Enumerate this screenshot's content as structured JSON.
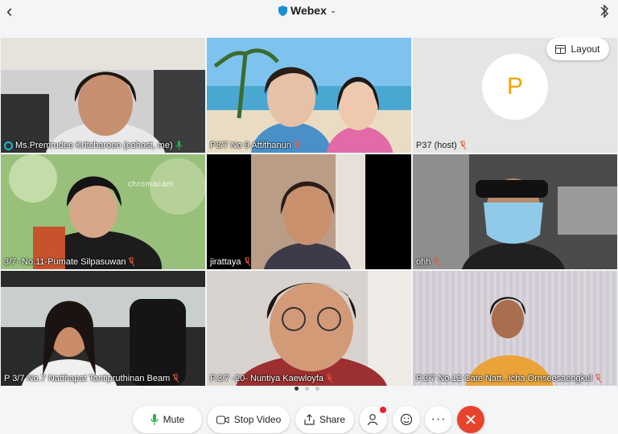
{
  "header": {
    "title": "Webex",
    "brand_color": "#1a8fd8"
  },
  "layout_button": {
    "label": "Layout",
    "icon": "layout-grid-icon"
  },
  "tiles": [
    {
      "name": "Ms.Premrudee Kritcharoen (cohost, me)",
      "mic": "green",
      "active": true
    },
    {
      "name": "P3/7 No 9 Attithanun",
      "mic": "muted"
    },
    {
      "name": "P37 (host)",
      "mic": "muted",
      "avatar_letter": "P"
    },
    {
      "name": "3/7- No.11-Pumate Silpasuwan",
      "mic": "muted",
      "overlay_text": "chromacam"
    },
    {
      "name": "jirattaya",
      "mic": "muted"
    },
    {
      "name": "ohh",
      "mic": "muted"
    },
    {
      "name": "P 3/7 No.7 Natthapat Tantipruthinan Beam",
      "mic": "muted"
    },
    {
      "name": "P.3/7 -20- Nuntiya Kaewloyfa",
      "mic": "muted"
    },
    {
      "name": "P.3/7 No.12 Cate Natt...icha Ornseesaengkul",
      "mic": "muted"
    }
  ],
  "pagination": {
    "pages": 3,
    "current": 1
  },
  "toolbar": {
    "mute": "Mute",
    "stop_video": "Stop Video",
    "share": "Share"
  },
  "colors": {
    "mic_green": "#2bb24c",
    "mic_muted": "#e85a3a",
    "end_red": "#e8432c",
    "active_border": "#22b5cf"
  }
}
